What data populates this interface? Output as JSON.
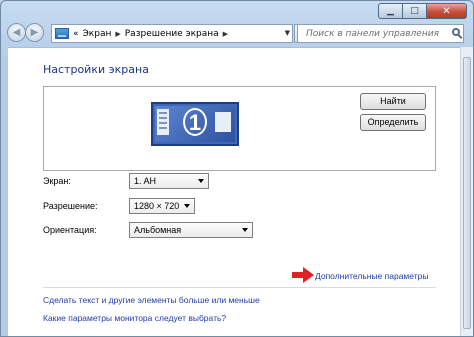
{
  "window": {
    "controls": {
      "min": "▁",
      "max": "□",
      "close": "✕"
    }
  },
  "navbar": {
    "back_icon": "◀",
    "fwd_icon": "▶",
    "breadcrumb": [
      "«",
      "Экран",
      "Разрешение экрана"
    ],
    "search_placeholder": "Поиск в панели управления"
  },
  "main": {
    "heading": "Настройки экрана",
    "buttons": {
      "find": "Найти",
      "detect": "Определить"
    },
    "monitor_number": "1",
    "rows": {
      "screen": {
        "label": "Экран:",
        "value": "1. AH"
      },
      "resolution": {
        "label": "Разрешение:",
        "value": "1280 × 720"
      },
      "orientation": {
        "label": "Ориентация:",
        "value": "Альбомная"
      }
    },
    "links": {
      "advanced": "Дополнительные параметры",
      "text_size": "Сделать текст и другие элементы больше или меньше",
      "which_settings": "Какие параметры монитора следует выбрать?"
    }
  },
  "colors": {
    "accent": "#1e3fa8",
    "heading": "#1e3287",
    "arrow": "#e31e24"
  }
}
